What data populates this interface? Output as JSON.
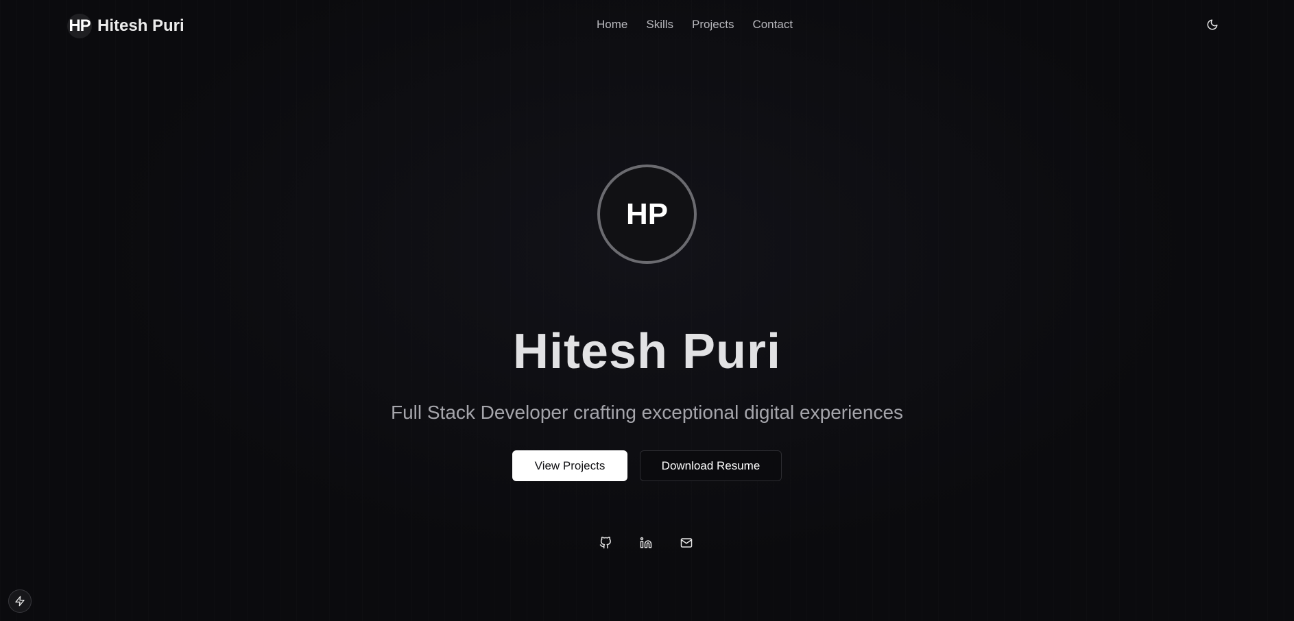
{
  "navbar": {
    "brand_logo_text": "HP",
    "brand_name": "Hitesh Puri",
    "links": [
      {
        "label": "Home"
      },
      {
        "label": "Skills"
      },
      {
        "label": "Projects"
      },
      {
        "label": "Contact"
      }
    ],
    "theme_toggle_icon": "moon-icon"
  },
  "hero": {
    "avatar_initials": "HP",
    "name": "Hitesh Puri",
    "tagline": "Full Stack Developer crafting exceptional digital experiences",
    "primary_button": "View Projects",
    "secondary_button": "Download Resume",
    "socials": [
      {
        "icon": "github-icon"
      },
      {
        "icon": "linkedin-icon"
      },
      {
        "icon": "mail-icon"
      }
    ]
  },
  "floating_button_icon": "lightning-icon",
  "colors": {
    "background": "#0b0b0e",
    "primary_button_bg": "#ffffff",
    "text": "#ececec",
    "muted_text": "#a5a5ab",
    "avatar_ring": "#6b6b70"
  }
}
